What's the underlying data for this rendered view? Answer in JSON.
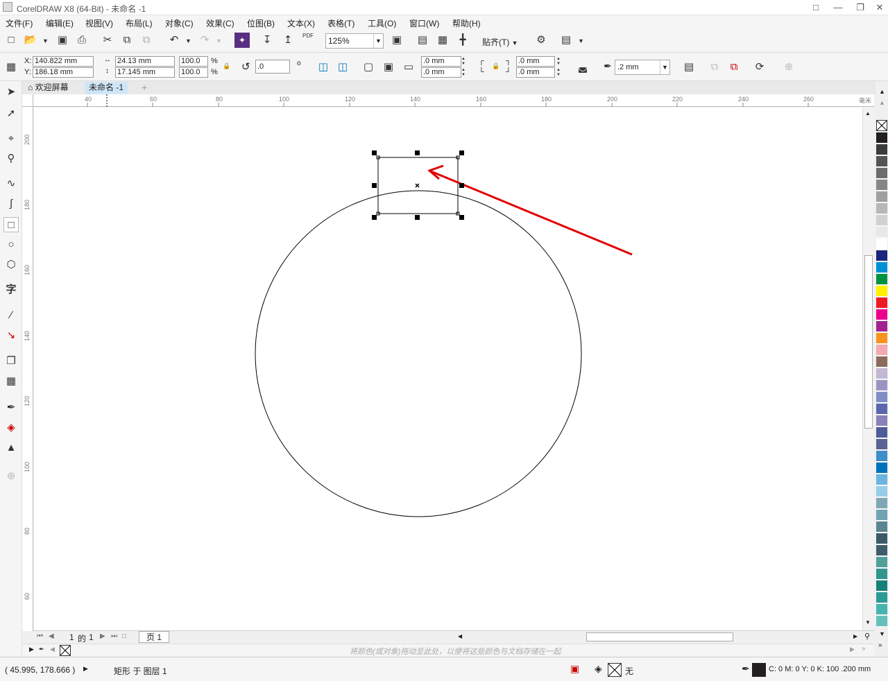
{
  "window": {
    "title": "CorelDRAW X8 (64-Bit) - 未命名 -1"
  },
  "menu": [
    "文件(F)",
    "编辑(E)",
    "视图(V)",
    "布局(L)",
    "对象(C)",
    "效果(C)",
    "位图(B)",
    "文本(X)",
    "表格(T)",
    "工具(O)",
    "窗口(W)",
    "帮助(H)"
  ],
  "toolbar": {
    "zoom_value": "125%",
    "snap_label": "贴齐(T)",
    "pdf_label": "PDF"
  },
  "properties": {
    "x_label": "X:",
    "x_value": "140.822 mm",
    "y_label": "Y:",
    "y_value": "186.18 mm",
    "width_value": "24.13 mm",
    "height_value": "17.145 mm",
    "scale_w": "100.0",
    "scale_h": "100.0",
    "percent": "%",
    "rotation": ".0",
    "degree": "o",
    "corner_1": ".0 mm",
    "corner_2": ".0 mm",
    "corner_3": ".0 mm",
    "corner_4": ".0 mm",
    "outline_width": ".2 mm"
  },
  "tabs": {
    "welcome": "欢迎屏幕",
    "document": "未命名 -1"
  },
  "ruler": {
    "h_ticks": [
      "40",
      "60",
      "80",
      "100",
      "120",
      "140",
      "160",
      "180",
      "200",
      "220",
      "240",
      "260"
    ],
    "v_ticks": [
      "200",
      "180",
      "160",
      "140",
      "120",
      "100",
      "80",
      "60"
    ],
    "unit": "毫米"
  },
  "pages": {
    "current": "1",
    "of_label": "的",
    "total": "1",
    "page_tab": "页 1"
  },
  "color_tray": {
    "hint": "将颜色(或对象)拖动至此处，以便将这些颜色与文档存储在一起"
  },
  "status": {
    "coords": "( 45.995, 178.666 )",
    "object_info": "矩形 于 图层 1",
    "fill_label": "无",
    "outline_info": "C: 0 M: 0 Y: 0 K: 100  .200 mm"
  },
  "palette_colors": [
    "#231f20",
    "#3b3b3b",
    "#545454",
    "#6d6d6d",
    "#868686",
    "#9f9f9f",
    "#b8b8b8",
    "#d1d1d1",
    "#e8e8e8",
    "#ffffff",
    "#1a237e",
    "#0091d5",
    "#00923f",
    "#fff200",
    "#ed1c24",
    "#ec008c",
    "#a3238e",
    "#f7941d",
    "#f4a9b0",
    "#8b6c5c",
    "#c3b7d6",
    "#9d93c3",
    "#7f8fc6",
    "#5b66ad",
    "#8a83b7",
    "#4f5d96",
    "#5a6492",
    "#3e8ec7",
    "#0072bc",
    "#6bb5e0",
    "#98cde9",
    "#7fa7b6",
    "#72a3b3",
    "#5c8593",
    "#3b5a68",
    "#3f5c6b",
    "#53a09a",
    "#31958d",
    "#16817a",
    "#2c9a95",
    "#46b4b0",
    "#65c0bc"
  ]
}
